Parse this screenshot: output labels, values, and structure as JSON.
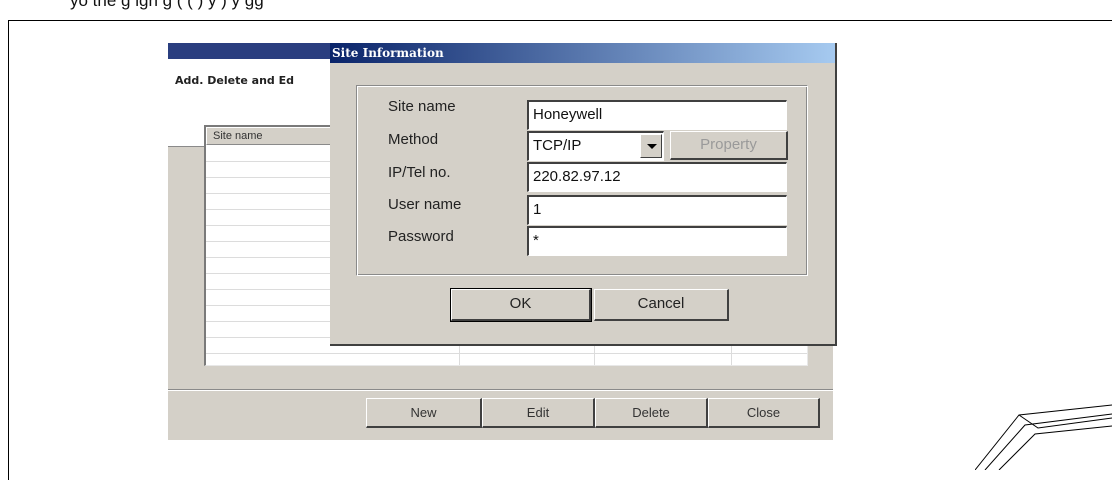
{
  "caption": "yo  the  g  ign  g  (   (  )      y     )              y gg",
  "background_window": {
    "header_title": "Add. Delete and Ed",
    "columns": [
      "Site name"
    ],
    "buttons": {
      "new": "New",
      "edit": "Edit",
      "delete": "Delete",
      "close": "Close"
    }
  },
  "dialog": {
    "title": "Site Information",
    "labels": {
      "site_name": "Site name",
      "method": "Method",
      "ip_tel": "IP/Tel no.",
      "user_name": "User name",
      "password": "Password"
    },
    "values": {
      "site_name": "Honeywell",
      "method": "TCP/IP",
      "ip_tel": "220.82.97.12",
      "user_name": "1",
      "password": "*"
    },
    "property_button": "Property",
    "ok_button": "OK",
    "cancel_button": "Cancel"
  }
}
